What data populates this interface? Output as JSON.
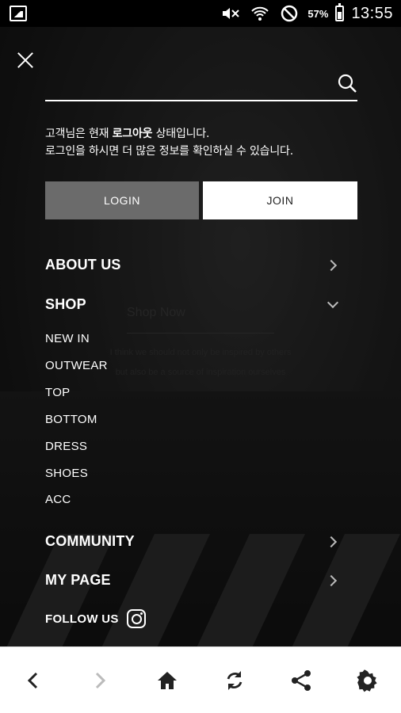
{
  "status_bar": {
    "battery_percent": "57%",
    "time": "13:55"
  },
  "background": {
    "title": "Shop Now",
    "line1": "I think we should not only be inspired by others",
    "line2": "but also be a source of inspiration ourselves"
  },
  "menu": {
    "search": {
      "placeholder": ""
    },
    "notice_line1_prefix": "고객님은 현재 ",
    "notice_line1_bold": "로그아웃",
    "notice_line1_suffix": " 상태입니다.",
    "notice_line2": "로그인을 하시면 더 많은 정보를 확인하실 수 있습니다.",
    "login_label": "LOGIN",
    "join_label": "JOIN",
    "items": [
      {
        "label": "ABOUT US"
      },
      {
        "label": "SHOP"
      },
      {
        "label": "COMMUNITY"
      },
      {
        "label": "MY PAGE"
      }
    ],
    "shop_sub": [
      "NEW IN",
      "OUTWEAR",
      "TOP",
      "BOTTOM",
      "DRESS",
      "SHOES",
      "ACC"
    ],
    "follow_label": "FOLLOW US"
  },
  "colors": {
    "login_bg": "#6b6b6b",
    "join_bg": "#ffffff",
    "overlay": "rgba(0,0,0,0.45)"
  },
  "icons": [
    "close-icon",
    "search-icon",
    "chevron-right-icon",
    "chevron-down-icon",
    "instagram-icon",
    "back-icon",
    "forward-icon",
    "home-icon",
    "refresh-icon",
    "share-icon",
    "settings-icon"
  ]
}
